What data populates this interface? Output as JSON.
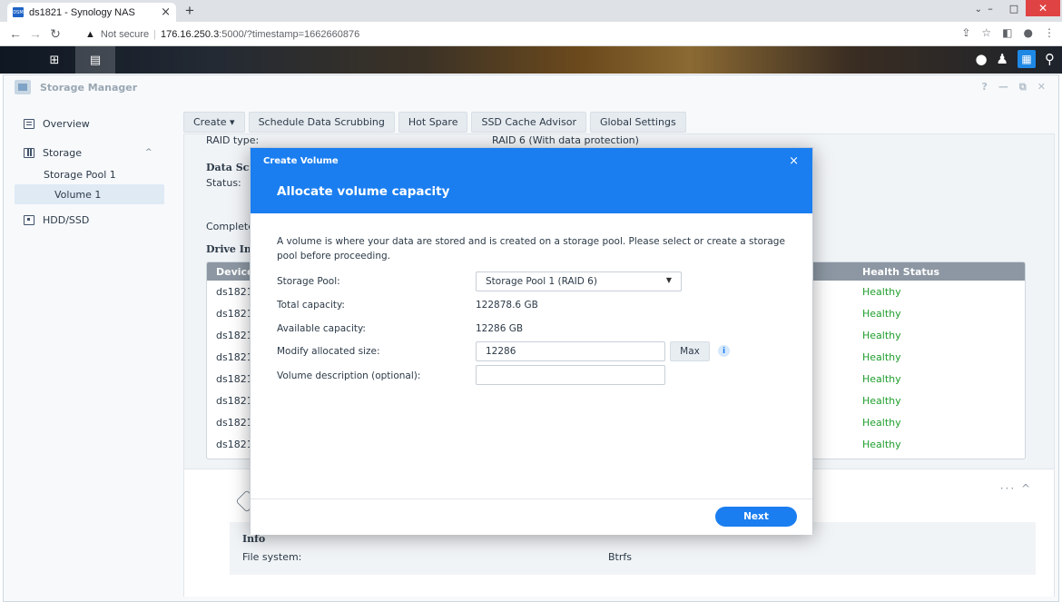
{
  "browser": {
    "tab_title": "ds1821 - Synology NAS",
    "tab_favicon_text": "DSM",
    "tab_close": "×",
    "new_tab": "+",
    "not_secure": "Not secure",
    "url_host": "176.16.250.3",
    "url_rest": ":5000/?timestamp=1662660876"
  },
  "window": {
    "title": "Storage Manager",
    "controls": [
      "?",
      "—",
      "⧉",
      "✕"
    ]
  },
  "sidebar": {
    "overview": "Overview",
    "storage": "Storage",
    "storage_pool": "Storage Pool 1",
    "volume": "Volume 1",
    "hdd": "HDD/SSD"
  },
  "toolbar": {
    "create": "Create ▾",
    "schedule": "Schedule Data Scrubbing",
    "hot_spare": "Hot Spare",
    "ssd_cache": "SSD Cache Advisor",
    "global_settings": "Global Settings"
  },
  "background": {
    "raid_type_label": "RAID type:",
    "raid_type_value": "RAID 6 (With data protection)",
    "data_scrub": "Data Scru",
    "status": "Status:",
    "completed": "Completed",
    "drive_info": "Drive Inf",
    "col_device": "Device",
    "col_health": "Health Status",
    "rows": [
      {
        "device": "ds1821",
        "health": "Healthy"
      },
      {
        "device": "ds1821",
        "health": "Healthy"
      },
      {
        "device": "ds1821",
        "health": "Healthy"
      },
      {
        "device": "ds1821",
        "health": "Healthy"
      },
      {
        "device": "ds1821",
        "health": "Healthy"
      },
      {
        "device": "ds1821",
        "health": "Healthy"
      },
      {
        "device": "ds1821",
        "health": "Healthy"
      },
      {
        "device": "ds1821",
        "health": "Healthy"
      }
    ],
    "info_title": "Info",
    "file_system_label": "File system:",
    "file_system_value": "Btrfs",
    "card_more": "··· ^"
  },
  "dialog": {
    "title": "Create Volume",
    "close": "×",
    "heading": "Allocate volume capacity",
    "description": "A volume is where your data are stored and is created on a storage pool. Please select or create a storage pool before proceeding.",
    "storage_pool_label": "Storage Pool:",
    "storage_pool_value": "Storage Pool 1 (RAID 6)",
    "total_capacity_label": "Total capacity:",
    "total_capacity_value": "122878.6 GB",
    "available_capacity_label": "Available capacity:",
    "available_capacity_value": "12286 GB",
    "modify_size_label": "Modify allocated size:",
    "modify_size_value": "12286",
    "max_button": "Max",
    "info_icon": "i",
    "description_label": "Volume description (optional):",
    "description_value": "",
    "next_button": "Next"
  },
  "colors": {
    "accent": "#1a7ef0",
    "healthy": "#1f9e2c",
    "table_header": "#8c97a3"
  }
}
